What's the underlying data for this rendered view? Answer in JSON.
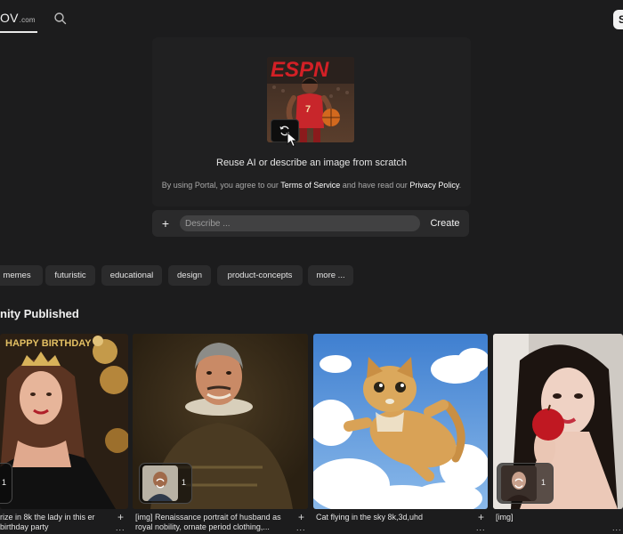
{
  "header": {
    "logo_text": "OV",
    "logo_suffix": ".com",
    "corner_label": "S"
  },
  "hero": {
    "image_brand": "ESPN",
    "image_jersey_number": "7",
    "title": "Reuse AI or describe an image from scratch",
    "terms_prefix": "By using Portal, you agree to our ",
    "terms_link": "Terms of Service",
    "terms_middle": " and have read our ",
    "privacy_link": "Privacy Policy",
    "terms_suffix": "."
  },
  "prompt": {
    "plus_label": "+",
    "placeholder": "Describe ...",
    "value": "",
    "create_label": "Create"
  },
  "chips": [
    "memes",
    "futuristic",
    "educational",
    "design",
    "product-concepts",
    "more ..."
  ],
  "section": {
    "title": "nity Published"
  },
  "cards": [
    {
      "caption": "rize in 8k the lady in this er birthday party",
      "count": "1",
      "banner": "HAPPY BIRTHDAY"
    },
    {
      "caption": "[img] Renaissance portrait of husband as royal nobility, ornate period clothing,...",
      "count": "1"
    },
    {
      "caption": "Cat flying in the sky 8k,3d,uhd",
      "count": ""
    },
    {
      "caption": "[img]",
      "count": "1"
    }
  ],
  "card_actions": {
    "plus": "+",
    "more": "..."
  },
  "colors": {
    "background": "#1c1c1d",
    "panel": "#202021",
    "chip": "#2b2b2c",
    "input": "#414142",
    "espn_red": "#d32026"
  }
}
